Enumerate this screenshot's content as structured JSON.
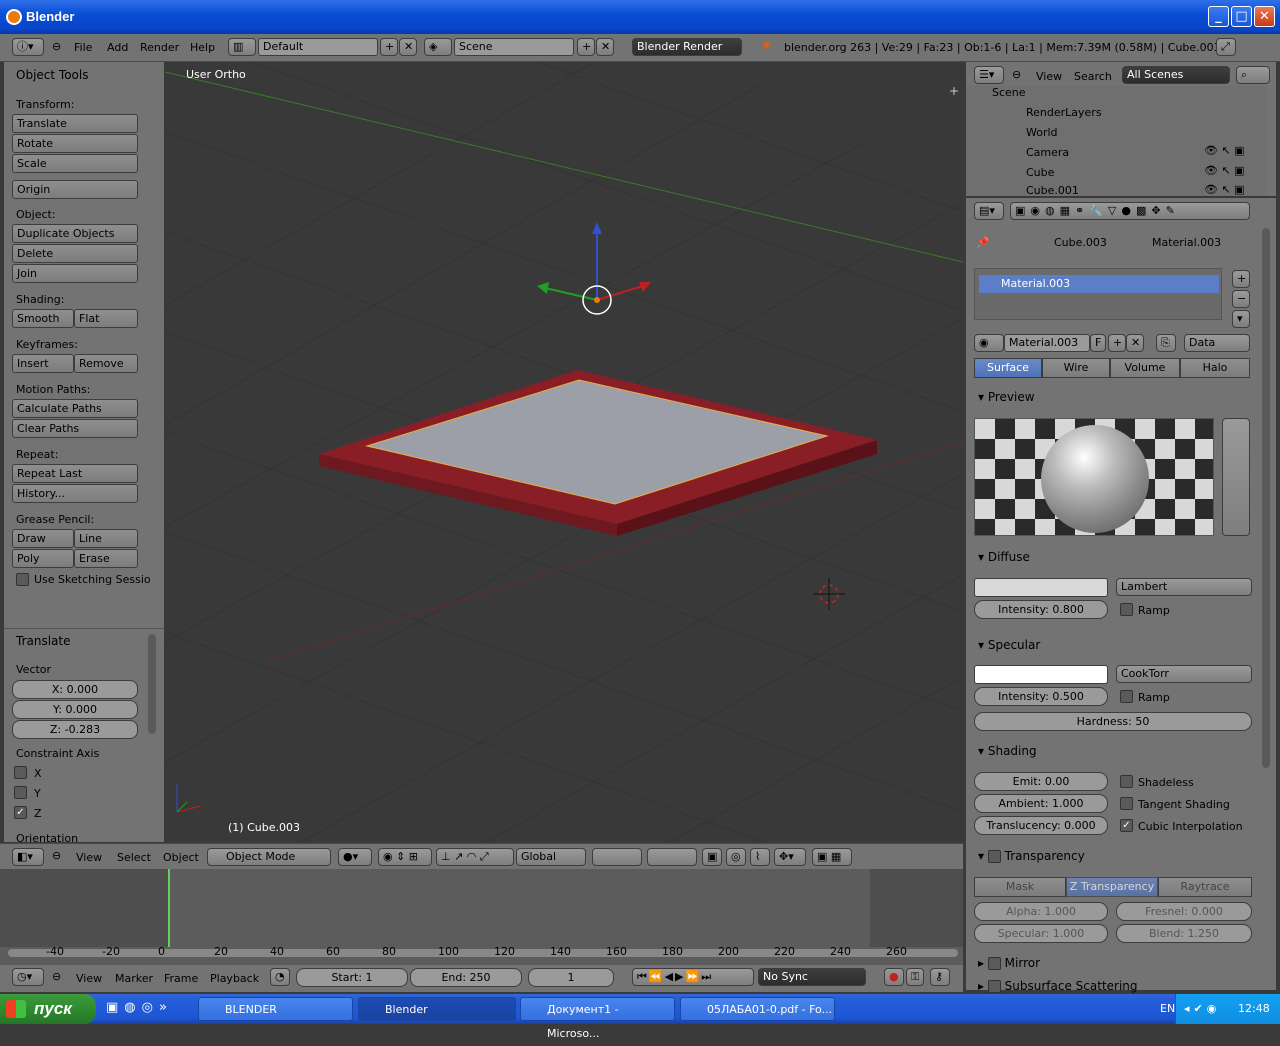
{
  "window": {
    "title": "Blender"
  },
  "header": {
    "menus": [
      "File",
      "Add",
      "Render",
      "Help"
    ],
    "layout": "Default",
    "scene": "Scene",
    "engine": "Blender Render",
    "info": "blender.org 263 | Ve:29 | Fa:23 | Ob:1-6 | La:1 | Mem:7.39M (0.58M) | Cube.003"
  },
  "tools": {
    "title": "Object Tools",
    "transform_label": "Transform:",
    "translate": "Translate",
    "rotate": "Rotate",
    "scale": "Scale",
    "origin": "Origin",
    "object_label": "Object:",
    "duplicate": "Duplicate Objects",
    "delete": "Delete",
    "join": "Join",
    "shading_label": "Shading:",
    "smooth": "Smooth",
    "flat": "Flat",
    "keyframes_label": "Keyframes:",
    "insert": "Insert",
    "remove": "Remove",
    "motion_label": "Motion Paths:",
    "calc_paths": "Calculate Paths",
    "clear_paths": "Clear Paths",
    "repeat_label": "Repeat:",
    "repeat_last": "Repeat Last",
    "history": "History...",
    "grease_label": "Grease Pencil:",
    "draw": "Draw",
    "line": "Line",
    "poly": "Poly",
    "erase": "Erase",
    "sketching": "Use Sketching Sessio"
  },
  "operator": {
    "title": "Translate",
    "vector_label": "Vector",
    "x": "X: 0.000",
    "y": "Y: 0.000",
    "z": "Z: -0.283",
    "constraint_label": "Constraint Axis",
    "cx": "X",
    "cy": "Y",
    "cz": "Z",
    "cz_checked": true,
    "orientation_label": "Orientation"
  },
  "viewport": {
    "view_label": "User Ortho",
    "object_label": "(1) Cube.003"
  },
  "viewport_header": {
    "menus": [
      "View",
      "Select",
      "Object"
    ],
    "mode": "Object Mode",
    "orientation": "Global"
  },
  "outliner": {
    "menus": [
      "View",
      "Search"
    ],
    "filter": "All Scenes",
    "items": [
      "Scene",
      "RenderLayers",
      "World",
      "Camera",
      "Cube",
      "Cube.001"
    ]
  },
  "properties": {
    "breadcrumb_object": "Cube.003",
    "breadcrumb_material": "Material.003",
    "slot": "Material.003",
    "material_name": "Material.003",
    "fake_user": "F",
    "link": "Data",
    "tabs": [
      "Surface",
      "Wire",
      "Volume",
      "Halo"
    ],
    "preview_title": "Preview",
    "diffuse": {
      "title": "Diffuse",
      "shader": "Lambert",
      "intensity": "Intensity: 0.800",
      "ramp": "Ramp",
      "color": "#d9d9d9"
    },
    "specular": {
      "title": "Specular",
      "shader": "CookTorr",
      "intensity": "Intensity: 0.500",
      "ramp": "Ramp",
      "hardness": "Hardness: 50",
      "color": "#ffffff"
    },
    "shading": {
      "title": "Shading",
      "emit": "Emit: 0.00",
      "ambient": "Ambient: 1.000",
      "translucency": "Translucency: 0.000",
      "shadeless": "Shadeless",
      "tangent": "Tangent Shading",
      "cubic": "Cubic Interpolation"
    },
    "transparency": {
      "title": "Transparency",
      "tabs": [
        "Mask",
        "Z Transparency",
        "Raytrace"
      ],
      "alpha": "Alpha: 1.000",
      "fresnel": "Fresnel: 0.000",
      "specular": "Specular: 1.000",
      "blend": "Blend: 1.250"
    },
    "mirror": "Mirror",
    "sss": "Subsurface Scattering"
  },
  "timeline": {
    "ticks": [
      "-40",
      "-20",
      "0",
      "20",
      "40",
      "60",
      "80",
      "100",
      "120",
      "140",
      "160",
      "180",
      "200",
      "220",
      "240",
      "260"
    ],
    "menus": [
      "View",
      "Marker",
      "Frame",
      "Playback"
    ],
    "start": "Start: 1",
    "end": "End: 250",
    "current": "1",
    "sync": "No Sync"
  },
  "taskbar": {
    "start": "пуск",
    "tasks": [
      "BLENDER",
      "Blender",
      "Документ1 - Microso...",
      "05ЛАБА01-0.pdf - Fo..."
    ],
    "lang": "EN",
    "clock": "12:48"
  }
}
